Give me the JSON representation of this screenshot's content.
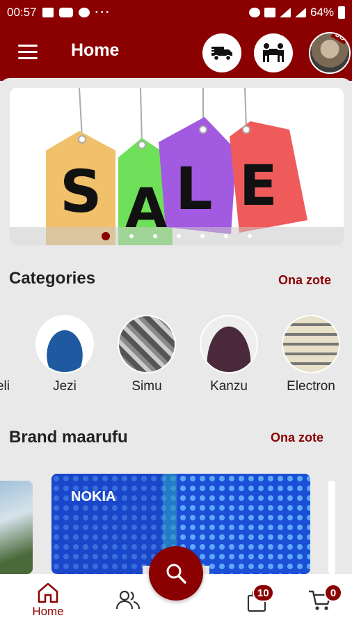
{
  "status_bar": {
    "time": "00:57",
    "battery": "64%"
  },
  "app_bar": {
    "title": "Home",
    "avatar_tag": "UG"
  },
  "banner": {
    "text_letters": [
      "S",
      "A",
      "L",
      "E"
    ],
    "slide_count": 7,
    "active_slide": 1
  },
  "categories": {
    "title": "Categories",
    "see_all": "Ona zote",
    "items": [
      {
        "label": "Vifaa vya Kielektroniki cha kueli",
        "visible_label": "eli"
      },
      {
        "label": "Jezi",
        "visible_label": "Jezi"
      },
      {
        "label": "Simu",
        "visible_label": "Simu"
      },
      {
        "label": "Kanzu",
        "visible_label": "Kanzu"
      },
      {
        "label": "Electronics",
        "visible_label": "Electron"
      }
    ]
  },
  "brands": {
    "title": "Brand maarufu",
    "see_all": "Ona zote",
    "featured_name": "NOKIA"
  },
  "bottom_nav": {
    "home_label": "Home",
    "orders_badge": "10",
    "cart_badge": "0"
  },
  "colors": {
    "primary": "#8b0000",
    "background": "#e9e9e9"
  }
}
